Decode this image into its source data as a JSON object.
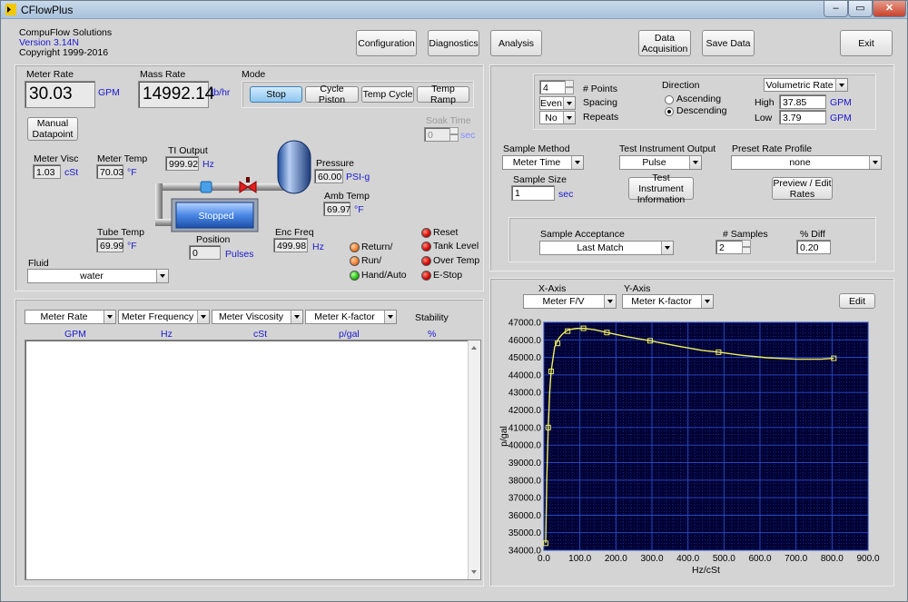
{
  "window": {
    "title": "CFlowPlus"
  },
  "company": {
    "name": "CompuFlow Solutions",
    "version": "Version 3.14N",
    "copyright": "Copyright 1999-2016"
  },
  "toolbar": {
    "configuration": "Configuration",
    "diagnostics": "Diagnostics",
    "analysis": "Analysis",
    "data_acq_line1": "Data",
    "data_acq_line2": "Acquisition",
    "save_data": "Save Data",
    "exit": "Exit"
  },
  "meter_rate": {
    "label": "Meter Rate",
    "value": "30.03",
    "unit": "GPM"
  },
  "mass_rate": {
    "label": "Mass Rate",
    "value": "14992.14",
    "unit": "lb/hr"
  },
  "mode": {
    "label": "Mode",
    "buttons": [
      "Stop",
      "Cycle Piston",
      "Temp Cycle",
      "Temp Ramp"
    ],
    "active": "Stop"
  },
  "manual_datapoint": {
    "line1": "Manual",
    "line2": "Datapoint"
  },
  "soak_time": {
    "label": "Soak Time",
    "value": "0",
    "unit": "sec"
  },
  "meter_visc": {
    "label": "Meter Visc",
    "value": "1.03",
    "unit": "cSt"
  },
  "meter_temp": {
    "label": "Meter Temp",
    "value": "70.03",
    "unit": "°F"
  },
  "ti_output": {
    "label": "TI Output",
    "value": "999.92",
    "unit": "Hz"
  },
  "pressure": {
    "label": "Pressure",
    "value": "60.00",
    "unit": "PSI-g"
  },
  "amb_temp": {
    "label": "Amb Temp",
    "value": "69.97",
    "unit": "°F"
  },
  "piston_status": "Stopped",
  "tube_temp": {
    "label": "Tube Temp",
    "value": "69.99",
    "unit": "°F"
  },
  "position": {
    "label": "Position",
    "value": "0",
    "unit": "Pulses"
  },
  "enc_freq": {
    "label": "Enc Freq",
    "value": "499.98",
    "unit": "Hz"
  },
  "leds_left": [
    {
      "label": "Return/",
      "color": "orange"
    },
    {
      "label": "Run/",
      "color": "orange"
    },
    {
      "label": "Hand/Auto",
      "color": "green"
    }
  ],
  "leds_right": [
    {
      "label": "Reset",
      "color": "red"
    },
    {
      "label": "Tank Level",
      "color": "red"
    },
    {
      "label": "Over Temp",
      "color": "red"
    },
    {
      "label": "E-Stop",
      "color": "red"
    }
  ],
  "fluid": {
    "label": "Fluid",
    "value": "water"
  },
  "table": {
    "columns": [
      {
        "select": "Meter Rate",
        "unit": "GPM"
      },
      {
        "select": "Meter Frequency",
        "unit": "Hz"
      },
      {
        "select": "Meter Viscosity",
        "unit": "cSt"
      },
      {
        "select": "Meter K-factor",
        "unit": "p/gal"
      }
    ],
    "stability": {
      "label": "Stability",
      "unit": "%"
    }
  },
  "points": {
    "value": "4",
    "label": "# Points"
  },
  "spacing": {
    "value": "Even",
    "label": "Spacing"
  },
  "repeats": {
    "value": "No",
    "label": "Repeats"
  },
  "direction": {
    "label": "Direction",
    "options": [
      "Ascending",
      "Descending"
    ],
    "selected": "Descending"
  },
  "rate_type": {
    "value": "Volumetric Rate"
  },
  "high": {
    "label": "High",
    "value": "37.85",
    "unit": "GPM"
  },
  "low": {
    "label": "Low",
    "value": "3.79",
    "unit": "GPM"
  },
  "sample_method": {
    "label": "Sample Method",
    "value": "Meter Time"
  },
  "test_instrument_output": {
    "label": "Test Instrument Output",
    "value": "Pulse"
  },
  "preset_rate_profile": {
    "label": "Preset Rate Profile",
    "value": "none"
  },
  "sample_size": {
    "label": "Sample Size",
    "value": "1",
    "unit": "sec"
  },
  "test_instrument_info": {
    "line1": "Test Instrument",
    "line2": "Information"
  },
  "preview_edit": {
    "line1": "Preview / Edit",
    "line2": "Rates"
  },
  "sample_acceptance": {
    "label": "Sample Acceptance",
    "value": "Last Match"
  },
  "num_samples": {
    "label": "# Samples",
    "value": "2"
  },
  "pct_diff": {
    "label": "% Diff",
    "value": "0.20"
  },
  "graph": {
    "x_axis_label": "X-Axis",
    "x_axis_value": "Meter F/V",
    "y_axis_label": "Y-Axis",
    "y_axis_value": "Meter K-factor",
    "edit": "Edit"
  },
  "colors": {
    "plot_bg": "#000033",
    "grid": "#2a4fd0",
    "trace": "#f0f060",
    "panel": "#d4d4d4",
    "unit_blue": "#1a1ad0"
  },
  "chart_data": {
    "type": "line",
    "xlabel": "Hz/cSt",
    "ylabel": "p/gal",
    "xlim": [
      0,
      900
    ],
    "ylim": [
      34000,
      47000
    ],
    "x_ticks": [
      "0.0",
      "100.0",
      "200.0",
      "300.0",
      "400.0",
      "500.0",
      "600.0",
      "700.0",
      "800.0",
      "900.0"
    ],
    "y_ticks": [
      "34000.0",
      "35000.0",
      "36000.0",
      "37000.0",
      "38000.0",
      "39000.0",
      "40000.0",
      "41000.0",
      "42000.0",
      "43000.0",
      "44000.0",
      "45000.0",
      "46000.0",
      "47000.0"
    ],
    "series": [
      {
        "curve_x": [
          5,
          8,
          12,
          16,
          20,
          25,
          30,
          40,
          50,
          60,
          70,
          90,
          110,
          140,
          175,
          230,
          295,
          370,
          440,
          485,
          550,
          620,
          700,
          770,
          805
        ],
        "curve_y": [
          34400,
          38000,
          41000,
          43000,
          44200,
          44900,
          45600,
          46050,
          46300,
          46480,
          46580,
          46650,
          46660,
          46580,
          46420,
          46180,
          45950,
          45650,
          45400,
          45300,
          45120,
          44980,
          44900,
          44900,
          44950
        ],
        "marker_x": [
          5,
          12,
          20,
          38,
          66,
          110,
          175,
          295,
          485,
          805
        ],
        "marker_y": [
          34400,
          41000,
          44200,
          45800,
          46500,
          46660,
          46420,
          45950,
          45300,
          44950
        ]
      }
    ]
  }
}
